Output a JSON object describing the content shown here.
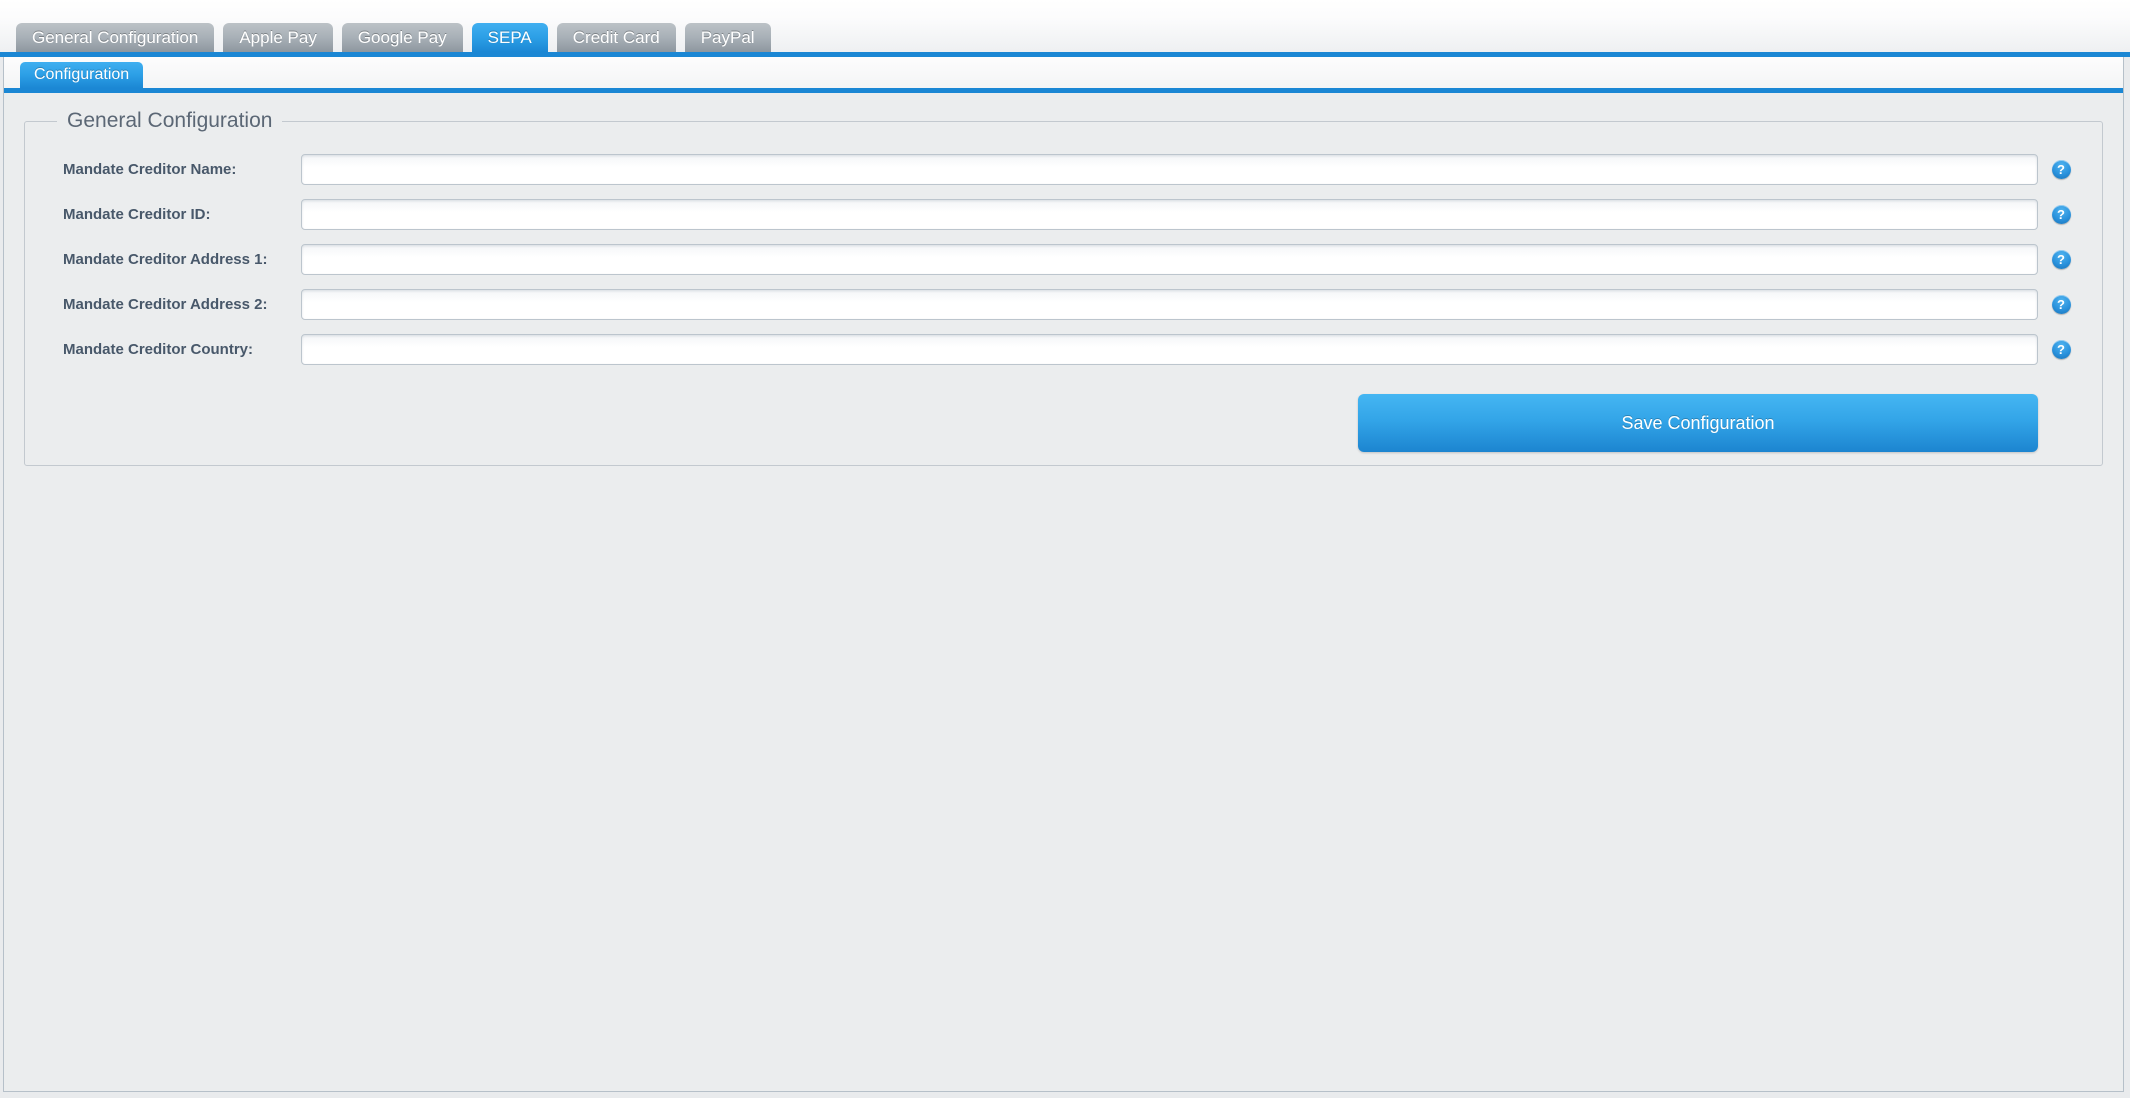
{
  "top_tabs": [
    {
      "label": "General Configuration",
      "active": false
    },
    {
      "label": "Apple Pay",
      "active": false
    },
    {
      "label": "Google Pay",
      "active": false
    },
    {
      "label": "SEPA",
      "active": true
    },
    {
      "label": "Credit Card",
      "active": false
    },
    {
      "label": "PayPal",
      "active": false
    }
  ],
  "sub_tabs": [
    {
      "label": "Configuration",
      "active": true
    }
  ],
  "group": {
    "legend": "General Configuration",
    "fields": [
      {
        "label": "Mandate Creditor Name:",
        "value": "",
        "placeholder": "",
        "help": "?"
      },
      {
        "label": "Mandate Creditor ID:",
        "value": "",
        "placeholder": "",
        "help": "?"
      },
      {
        "label": "Mandate Creditor Address 1:",
        "value": "",
        "placeholder": "",
        "help": "?"
      },
      {
        "label": "Mandate Creditor Address 2:",
        "value": "",
        "placeholder": "",
        "help": "?"
      },
      {
        "label": "Mandate Creditor Country:",
        "value": "",
        "placeholder": "",
        "help": "?"
      }
    ]
  },
  "actions": {
    "save_label": "Save Configuration"
  },
  "icons": {
    "help": "help-question-icon"
  },
  "colors": {
    "accent": "#1b87d4",
    "tab_inactive": "#a8b0b7",
    "panel_bg": "#ebedee",
    "label_text": "#48586a",
    "legend_text": "#5b6775"
  }
}
